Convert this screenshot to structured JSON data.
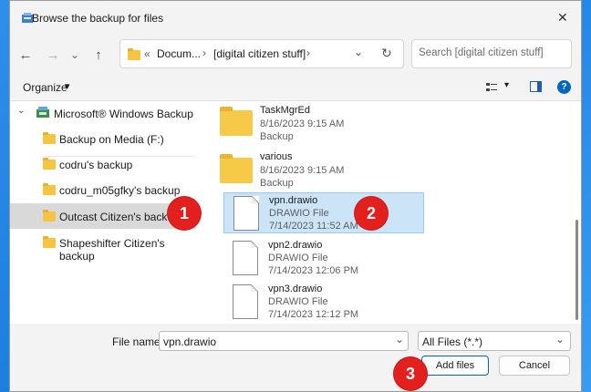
{
  "window": {
    "title": "Browse the backup for files",
    "close_glyph": "✕"
  },
  "nav": {
    "back": "←",
    "forward": "→",
    "recent": "⌄",
    "up": "↑",
    "address_chevrons": "«",
    "breadcrumb": [
      "Docum...",
      "[digital citizen stuff]"
    ],
    "sep": "›",
    "search_placeholder": "Search [digital citizen stuff]"
  },
  "command_bar": {
    "organize_label": "Organize",
    "organize_caret": "▾"
  },
  "sidebar": {
    "root": "Microsoft® Windows Backup",
    "items": [
      {
        "label": "Backup on Media (F:)"
      },
      {
        "label": "codru's backup"
      },
      {
        "label": "codru_m05gfky's backup"
      },
      {
        "label": "Outcast Citizen's backup",
        "selected": true
      },
      {
        "label": "Shapeshifter Citizen's backup"
      }
    ]
  },
  "files": [
    {
      "name": "TaskMgrEd",
      "date": "8/16/2023 9:15 AM",
      "type": "Backup",
      "kind": "folder"
    },
    {
      "name": "various",
      "date": "8/16/2023 9:15 AM",
      "type": "Backup",
      "kind": "folder"
    },
    {
      "name": "vpn.drawio",
      "type": "DRAWIO File",
      "date": "7/14/2023 11:52 AM",
      "kind": "file",
      "selected": true
    },
    {
      "name": "vpn2.drawio",
      "type": "DRAWIO File",
      "date": "7/14/2023 12:06 PM",
      "kind": "file"
    },
    {
      "name": "vpn3.drawio",
      "type": "DRAWIO File",
      "date": "7/14/2023 12:12 PM",
      "kind": "file"
    }
  ],
  "footer": {
    "filename_label": "File name:",
    "filename_value": "vpn.drawio",
    "filter_value": "All Files (*.*)",
    "add_label": "Add files",
    "cancel_label": "Cancel"
  },
  "badges": [
    "1",
    "2",
    "3"
  ],
  "colors": {
    "badge": "#e4201f",
    "selection": "#cce4f7",
    "accent": "#0067c0"
  }
}
